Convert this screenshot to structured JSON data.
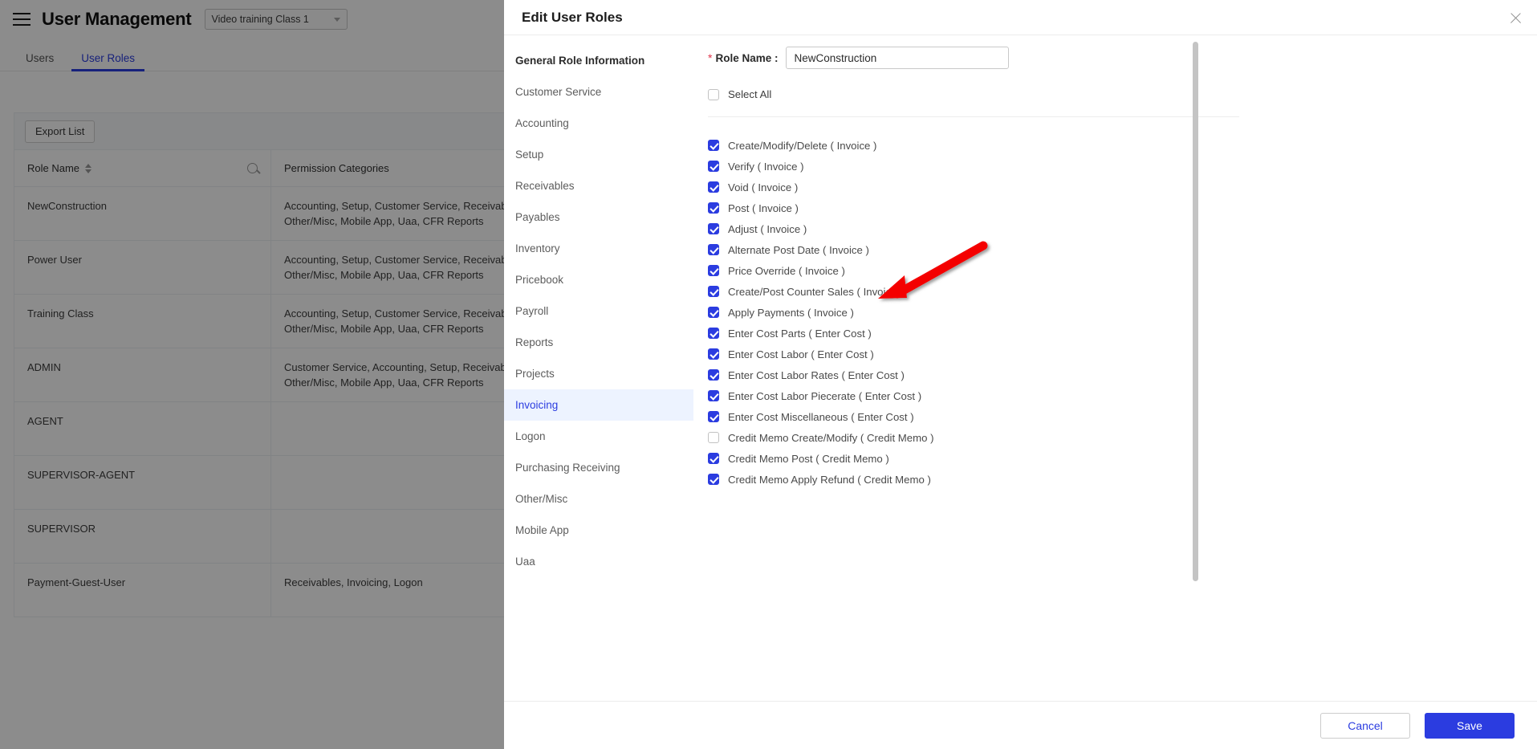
{
  "background": {
    "header": {
      "menu_icon": "hamburger-icon",
      "title": "User Management",
      "class_selector": {
        "value": "Video training Class 1",
        "icon": "chevron-down-icon"
      }
    },
    "tabs": [
      {
        "label": "Users",
        "active": false
      },
      {
        "label": "User Roles",
        "active": true
      }
    ],
    "toolbar": {
      "export_label": "Export List"
    },
    "table": {
      "columns": [
        {
          "label": "Role Name",
          "sortable": true,
          "searchable": true,
          "search_icon": "search-icon"
        },
        {
          "label": "Permission Categories",
          "sortable": false,
          "searchable": false
        }
      ],
      "rows": [
        {
          "role_name": "NewConstruction",
          "permissions": "Accounting, Setup, Customer Service, Receivables, Payables, Inventory, Pricebook, Payroll, Reports, Projects, Invoicing, Other/Misc, Mobile App, Uaa, CFR Reports"
        },
        {
          "role_name": "Power User",
          "permissions": "Accounting, Setup, Customer Service, Receivables, Payables, Inventory, Pricebook, Payroll, Reports, Projects, Invoicing, Other/Misc, Mobile App, Uaa, CFR Reports"
        },
        {
          "role_name": "Training Class",
          "permissions": "Accounting, Setup, Customer Service, Receivables, Payables, Inventory, Pricebook, Payroll, Reports, Projects, Invoicing, Other/Misc, Mobile App, Uaa, CFR Reports"
        },
        {
          "role_name": "ADMIN",
          "permissions": "Customer Service, Accounting, Setup, Receivables, Payables, Inventory, Pricebook, Payroll, Reports, Projects, Invoicing, Other/Misc, Mobile App, Uaa, CFR Reports"
        },
        {
          "role_name": "AGENT",
          "permissions": ""
        },
        {
          "role_name": "SUPERVISOR-AGENT",
          "permissions": ""
        },
        {
          "role_name": "SUPERVISOR",
          "permissions": ""
        },
        {
          "role_name": "Payment-Guest-User",
          "permissions": "Receivables, Invoicing, Logon"
        }
      ]
    }
  },
  "modal": {
    "title": "Edit User Roles",
    "close_icon": "close-icon",
    "nav": {
      "items": [
        {
          "label": "General Role Information",
          "heading": true,
          "active": false
        },
        {
          "label": "Customer Service",
          "heading": false,
          "active": false
        },
        {
          "label": "Accounting",
          "heading": false,
          "active": false
        },
        {
          "label": "Setup",
          "heading": false,
          "active": false
        },
        {
          "label": "Receivables",
          "heading": false,
          "active": false
        },
        {
          "label": "Payables",
          "heading": false,
          "active": false
        },
        {
          "label": "Inventory",
          "heading": false,
          "active": false
        },
        {
          "label": "Pricebook",
          "heading": false,
          "active": false
        },
        {
          "label": "Payroll",
          "heading": false,
          "active": false
        },
        {
          "label": "Reports",
          "heading": false,
          "active": false
        },
        {
          "label": "Projects",
          "heading": false,
          "active": false
        },
        {
          "label": "Invoicing",
          "heading": false,
          "active": true
        },
        {
          "label": "Logon",
          "heading": false,
          "active": false
        },
        {
          "label": "Purchasing Receiving",
          "heading": false,
          "active": false
        },
        {
          "label": "Other/Misc",
          "heading": false,
          "active": false
        },
        {
          "label": "Mobile App",
          "heading": false,
          "active": false
        },
        {
          "label": "Uaa",
          "heading": false,
          "active": false
        }
      ]
    },
    "form": {
      "role_name_label": "Role Name :",
      "role_name_required_marker": "*",
      "role_name_value": "NewConstruction",
      "role_name_placeholder": "",
      "select_all_label": "Select All",
      "select_all_checked": false
    },
    "permissions": [
      {
        "label": "Create/Modify/Delete ( Invoice )",
        "checked": true
      },
      {
        "label": "Verify ( Invoice )",
        "checked": true
      },
      {
        "label": "Void ( Invoice )",
        "checked": true
      },
      {
        "label": "Post ( Invoice )",
        "checked": true
      },
      {
        "label": "Adjust ( Invoice )",
        "checked": true
      },
      {
        "label": "Alternate Post Date ( Invoice )",
        "checked": true
      },
      {
        "label": "Price Override ( Invoice )",
        "checked": true
      },
      {
        "label": "Create/Post Counter Sales ( Invoice )",
        "checked": true
      },
      {
        "label": "Apply Payments ( Invoice )",
        "checked": true
      },
      {
        "label": "Enter Cost Parts ( Enter Cost )",
        "checked": true
      },
      {
        "label": "Enter Cost Labor ( Enter Cost )",
        "checked": true
      },
      {
        "label": "Enter Cost Labor Rates ( Enter Cost )",
        "checked": true
      },
      {
        "label": "Enter Cost Labor Piecerate ( Enter Cost )",
        "checked": true
      },
      {
        "label": "Enter Cost Miscellaneous ( Enter Cost )",
        "checked": true
      },
      {
        "label": "Credit Memo Create/Modify ( Credit Memo )",
        "checked": false
      },
      {
        "label": "Credit Memo Post ( Credit Memo )",
        "checked": true
      },
      {
        "label": "Credit Memo Apply Refund ( Credit Memo )",
        "checked": true
      }
    ],
    "footer": {
      "cancel_label": "Cancel",
      "save_label": "Save"
    }
  },
  "annotation": {
    "type": "arrow",
    "color": "#f40000",
    "points_to": "Create/Post Counter Sales ( Invoice )"
  },
  "colors": {
    "accent": "#2b3ce0",
    "active_nav_bg": "#edf3ff",
    "required_star": "#e0344a",
    "annotation_red": "#f40000",
    "toolbar_strip": "#f7f9fc"
  }
}
